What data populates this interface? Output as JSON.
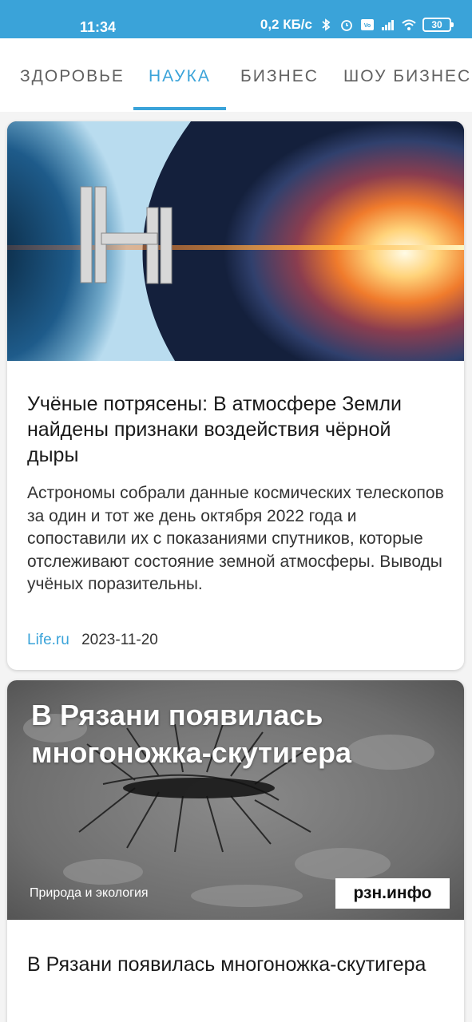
{
  "status_bar": {
    "time": "11:34",
    "network_speed": "0,2 КБ/с",
    "battery": "30",
    "icons": [
      "bluetooth-icon",
      "alarm-icon",
      "volte-icon",
      "signal-icon",
      "wifi-icon",
      "battery-icon"
    ]
  },
  "tabs": [
    {
      "label": "ЗДОРОВЬЕ",
      "active": false
    },
    {
      "label": "НАУКА",
      "active": true
    },
    {
      "label": "БИЗНЕС",
      "active": false
    },
    {
      "label": "ШОУ БИЗНЕС",
      "active": false
    }
  ],
  "articles": [
    {
      "image": "space-station-and-nebula",
      "title": "Учёные потрясены: В атмосфере Земли найдены признаки воздействия чёрной дыры",
      "description": "Астрономы собрали данные космических телескопов за один и тот же день октября 2022 года и сопоставили их с показаниями спутников, которые отслеживают состояние земной атмосферы. Выводы учёных поразительны.",
      "source": "Life.ru",
      "date": "2023-11-20"
    },
    {
      "image": "centipede-photo",
      "image_overlay_title": "В Рязани появилась многоножка-скутигера",
      "image_overlay_category": "Природа и экология",
      "image_overlay_logo": "рзн.инфо",
      "title": "В Рязани появилась многоножка-скутигера"
    }
  ],
  "colors": {
    "accent": "#3aa3d9",
    "background": "#f4f4f4",
    "card": "#ffffff"
  }
}
